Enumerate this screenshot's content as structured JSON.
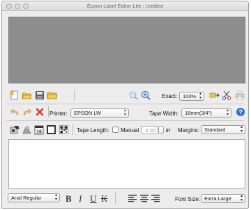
{
  "window": {
    "title": "Epson Label Editor Lite : Untitled"
  },
  "toolbar1": {
    "icons": [
      "new-label-icon",
      "open-icon",
      "save-icon",
      "folder-icon",
      "zoom-out-icon",
      "zoom-in-icon",
      "print-preview-icon",
      "cut-icon",
      "printer-icon"
    ],
    "exact_label": "Exact:",
    "zoom_value": "100%"
  },
  "toolbar2": {
    "icons": [
      "undo-icon",
      "redo-icon",
      "delete-icon",
      "help-icon"
    ],
    "printer_label": "Printer:",
    "printer_value": "EPSON LW",
    "tape_width_label": "Tape Width:",
    "tape_width_value": "18mm(3/4\")"
  },
  "toolbar3": {
    "icons": [
      "symbol-icon",
      "clipart-icon",
      "date-icon",
      "frame-icon",
      "qr-code-icon"
    ],
    "tape_length_label": "Tape Length:",
    "manual_label": "Manual",
    "manual_checked": false,
    "length_value": "0.00",
    "unit_label": "in",
    "margins_label": "Margins:",
    "margins_value": "Standard"
  },
  "format_bar": {
    "font_value": "Arial Regular",
    "bold_label": "B",
    "italic_label": "I",
    "underline_label": "U",
    "strikethrough_label": "K",
    "font_size_label": "Font Size:",
    "font_size_value": "Extra Large"
  },
  "colors": {
    "preview_bg": "#8e8e8e",
    "accent_blue": "#2f6fd0",
    "delete_red": "#d23a2a",
    "folder_yellow": "#e8b923"
  }
}
